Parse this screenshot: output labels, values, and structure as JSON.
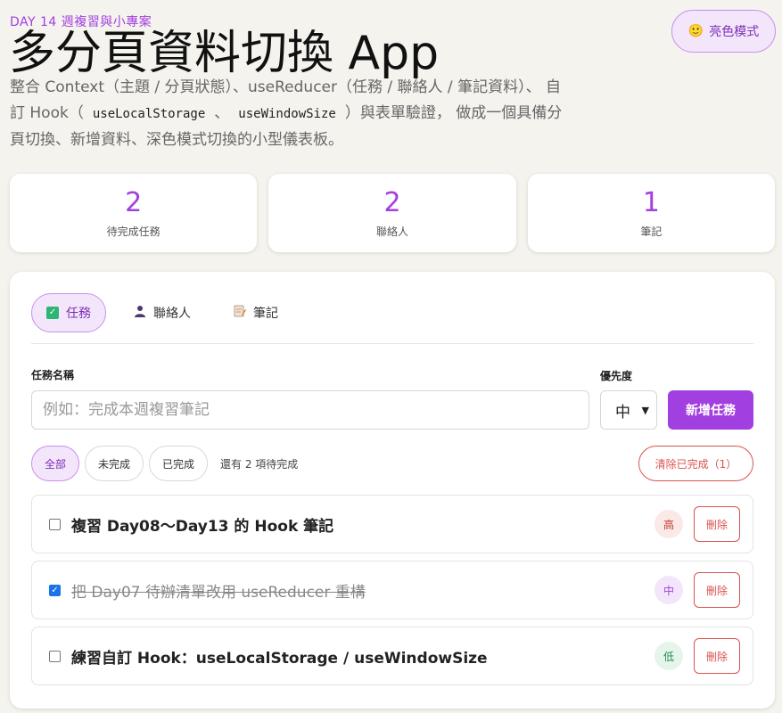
{
  "header": {
    "eyebrow": "DAY 14 週複習與小專案",
    "title": "多分頁資料切換 App",
    "desc_part1": "整合 Context（主題 / 分頁狀態）、useReducer（任務 / 聯絡人 / 筆記資料）、 自訂 Hook（",
    "code1": "useLocalStorage",
    "desc_sep": "、",
    "code2": "useWindowSize",
    "desc_part2": "）與表單驗證， 做成一個具備分頁切換、新增資料、深色模式切換的小型儀表板。",
    "theme_icon": "🙂",
    "theme_label": "亮色模式"
  },
  "stats": [
    {
      "value": "2",
      "label": "待完成任務"
    },
    {
      "value": "2",
      "label": "聯絡人"
    },
    {
      "value": "1",
      "label": "筆記"
    }
  ],
  "tabs": [
    {
      "label": "任務",
      "icon": "check-box-icon"
    },
    {
      "label": "聯絡人",
      "icon": "person-icon"
    },
    {
      "label": "筆記",
      "icon": "memo-icon"
    }
  ],
  "form": {
    "name_label": "任務名稱",
    "name_placeholder": "例如：完成本週複習筆記",
    "priority_label": "優先度",
    "priority_value": "中",
    "add_label": "新增任務"
  },
  "filters": {
    "all": "全部",
    "incomplete": "未完成",
    "complete": "已完成",
    "remaining": "還有 2 項待完成",
    "clear": "清除已完成（1）"
  },
  "tasks": [
    {
      "text": "複習 Day08～Day13 的 Hook 筆記",
      "done": false,
      "priority": "高",
      "delete": "刪除"
    },
    {
      "text": "把 Day07 待辦清單改用 useReducer 重構",
      "done": true,
      "priority": "中",
      "delete": "刪除"
    },
    {
      "text": "練習自訂 Hook：useLocalStorage / useWindowSize",
      "done": false,
      "priority": "低",
      "delete": "刪除"
    }
  ],
  "colors": {
    "accent": "#a23fe0",
    "danger": "#d9534f",
    "background": "#f4f3ee"
  }
}
